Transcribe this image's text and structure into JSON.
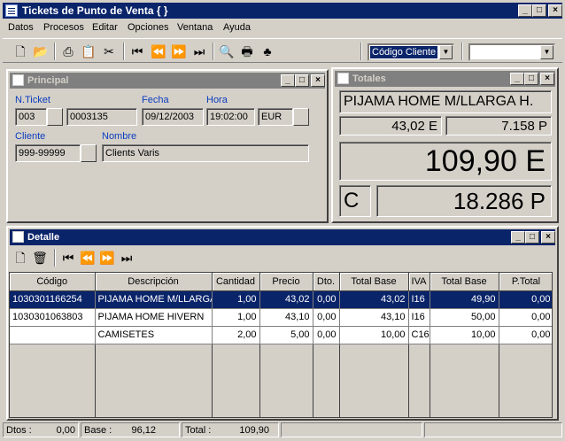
{
  "window": {
    "title": "Tickets de Punto de Venta { }"
  },
  "menu": [
    "Datos",
    "Procesos",
    "Editar",
    "Opciones",
    "Ventana",
    "Ayuda"
  ],
  "toolbar": {
    "search_combo": "Código Cliente",
    "extra_combo": ""
  },
  "principal": {
    "title": "Principal",
    "labels": {
      "nticket": "N.Ticket",
      "fecha": "Fecha",
      "hora": "Hora",
      "cliente": "Cliente",
      "nombre": "Nombre"
    },
    "values": {
      "serie": "003",
      "numero": "0003135",
      "fecha": "09/12/2003",
      "hora": "19:02:00",
      "moneda": "EUR",
      "cliente": "999-99999",
      "nombre": "Clients Varis"
    }
  },
  "totales": {
    "title": "Totales",
    "product": "PIJAMA HOME M/LLARGA H.",
    "price_eur": "43,02 E",
    "price_ptas": "7.158 P",
    "total_eur": "109,90 E",
    "code": "C",
    "total_ptas": "18.286 P"
  },
  "detalle": {
    "title": "Detalle",
    "columns": [
      "Código",
      "Descripción",
      "Cantidad",
      "Precio",
      "Dto.",
      "Total Base",
      "IVA",
      "Total Base",
      "P.Total"
    ],
    "rows": [
      [
        "1030301166254",
        "PIJAMA HOME M/LLARGA",
        "1,00",
        "43,02",
        "0,00",
        "43,02",
        "I16",
        "49,90",
        "0,00"
      ],
      [
        "1030301063803",
        "PIJAMA HOME HIVERN",
        "1,00",
        "43,10",
        "0,00",
        "43,10",
        "I16",
        "50,00",
        "0,00"
      ],
      [
        "",
        "CAMISETES",
        "2,00",
        "5,00",
        "0,00",
        "10,00",
        "C16",
        "10,00",
        "0,00"
      ]
    ]
  },
  "status": {
    "dtos_label": "Dtos :",
    "dtos_value": "0,00",
    "base_label": "Base :",
    "base_value": "96,12",
    "total_label": "Total :",
    "total_value": "109,90"
  }
}
